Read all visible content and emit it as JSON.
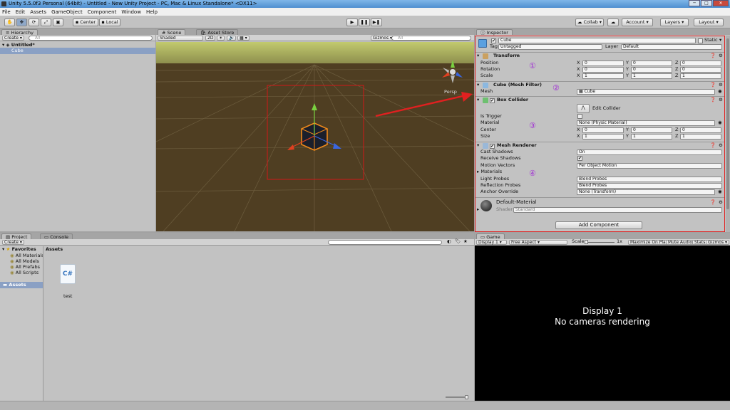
{
  "window": {
    "title": "Unity 5.5.0f3 Personal (64bit) - Untitled - New Unity Project - PC, Mac & Linux Standalone* <DX11>",
    "minimize": "─",
    "maximize": "□",
    "close": "✕"
  },
  "menu": [
    "File",
    "Edit",
    "Assets",
    "GameObject",
    "Component",
    "Window",
    "Help"
  ],
  "toolbar": {
    "pivot": "Center",
    "space": "Local",
    "collab": "Collab",
    "account": "Account",
    "layers": "Layers",
    "layout": "Layout"
  },
  "hierarchy": {
    "tab": "Hierarchy",
    "create": "Create",
    "search_placeholder": "All",
    "scene": "Untitled*",
    "items": [
      "Cube"
    ]
  },
  "scene": {
    "tab": "Scene",
    "tab2": "Asset Store",
    "shading": "Shaded",
    "mode2d": "2D",
    "gizmos": "Gizmos",
    "search_placeholder": "All",
    "persp": "Persp"
  },
  "inspector": {
    "tab": "Inspector",
    "object_name": "Cube",
    "static_label": "Static",
    "tag_label": "Tag",
    "tag_value": "Untagged",
    "layer_label": "Layer",
    "layer_value": "Default",
    "transform": {
      "title": "Transform",
      "rows": [
        {
          "label": "Position",
          "x": "0",
          "y": "0",
          "z": "0"
        },
        {
          "label": "Rotation",
          "x": "0",
          "y": "0",
          "z": "0"
        },
        {
          "label": "Scale",
          "x": "1",
          "y": "1",
          "z": "1"
        }
      ]
    },
    "mesh_filter": {
      "title": "Cube (Mesh Filter)",
      "mesh_label": "Mesh",
      "mesh_value": "Cube"
    },
    "box_collider": {
      "title": "Box Collider",
      "edit_label": "Edit Collider",
      "is_trigger": "Is Trigger",
      "material_label": "Material",
      "material_value": "None (Physic Material)",
      "center_label": "Center",
      "center": {
        "x": "0",
        "y": "0",
        "z": "0"
      },
      "size_label": "Size",
      "size": {
        "x": "1",
        "y": "1",
        "z": "1"
      }
    },
    "mesh_renderer": {
      "title": "Mesh Renderer",
      "rows": [
        {
          "label": "Cast Shadows",
          "value": "On"
        },
        {
          "label": "Receive Shadows",
          "value": "✔"
        },
        {
          "label": "Motion Vectors",
          "value": "Per Object Motion"
        },
        {
          "label": "Materials",
          "value": ""
        },
        {
          "label": "Light Probes",
          "value": "Blend Probes"
        },
        {
          "label": "Reflection Probes",
          "value": "Blend Probes"
        },
        {
          "label": "Anchor Override",
          "value": "None (Transform)"
        }
      ]
    },
    "material": {
      "name": "Default-Material",
      "shader_label": "Shader",
      "shader_value": "Standard"
    },
    "add_component": "Add Component",
    "annotations": [
      "①",
      "②",
      "③",
      "④"
    ],
    "accent_color": "#e02020"
  },
  "project": {
    "tab": "Project",
    "tab2": "Console",
    "create": "Create",
    "favorites": "Favorites",
    "favorite_items": [
      "All Materials",
      "All Models",
      "All Prefabs",
      "All Scripts"
    ],
    "assets_root": "Assets",
    "assets_header": "Assets",
    "files": [
      {
        "name": "test",
        "icon": "csharp-script-icon",
        "glyph": "C#"
      }
    ]
  },
  "game": {
    "tab": "Game",
    "display": "Display 1",
    "aspect": "Free Aspect",
    "scale_label": "Scale",
    "scale_value": "1x",
    "buttons": [
      "Maximize On Play",
      "Mute Audio",
      "Stats",
      "Gizmos"
    ],
    "message_line1": "Display 1",
    "message_line2": "No cameras rendering"
  }
}
